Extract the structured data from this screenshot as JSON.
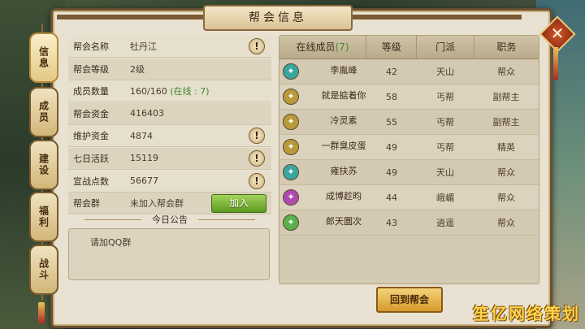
{
  "window": {
    "title": "帮会信息"
  },
  "side_tabs": [
    {
      "label": "信息",
      "active": true
    },
    {
      "label": "成员",
      "active": false
    },
    {
      "label": "建设",
      "active": false
    },
    {
      "label": "福利",
      "active": false
    },
    {
      "label": "战斗",
      "active": false
    }
  ],
  "guild_info": {
    "name_label": "帮会名称",
    "name_value": "牡丹江",
    "level_label": "帮会等级",
    "level_value": "2级",
    "members_label": "成员数量",
    "members_value": "160/160",
    "members_online": "(在线 : 7)",
    "funds_label": "帮会资金",
    "funds_value": "416403",
    "upkeep_label": "维护资金",
    "upkeep_value": "4874",
    "weekly_label": "七日活跃",
    "weekly_value": "15119",
    "warpoints_label": "宣战点数",
    "warpoints_value": "56677",
    "group_label": "帮会群",
    "group_value": "未加入帮会群",
    "join_button": "加入",
    "alert_glyph": "!"
  },
  "notice": {
    "heading": "今日公告",
    "text": "请加QQ群"
  },
  "members_table": {
    "headers": [
      "在线成员",
      "等级",
      "门派",
      "职务"
    ],
    "online_count": "(7)",
    "rows": [
      {
        "name": "李胤峰",
        "level": "42",
        "sect": "天山",
        "role": "帮众",
        "icon_color": "#3aa6a0"
      },
      {
        "name": "就是掂着你",
        "level": "58",
        "sect": "丐帮",
        "role": "副帮主",
        "icon_color": "#b89a3a"
      },
      {
        "name": "冷灵素",
        "level": "55",
        "sect": "丐帮",
        "role": "副帮主",
        "icon_color": "#b89a3a"
      },
      {
        "name": "一群臭皮蛋",
        "level": "49",
        "sect": "丐帮",
        "role": "精英",
        "icon_color": "#b89a3a"
      },
      {
        "name": "雍扶苏",
        "level": "49",
        "sect": "天山",
        "role": "帮众",
        "icon_color": "#3aa6a0"
      },
      {
        "name": "成博趁昀",
        "level": "44",
        "sect": "峨嵋",
        "role": "帮众",
        "icon_color": "#b04ab0"
      },
      {
        "name": "郎天圜次",
        "level": "43",
        "sect": "逍遥",
        "role": "帮众",
        "icon_color": "#5ab04a"
      }
    ]
  },
  "return_button": "回到帮会",
  "close_glyph": "✕",
  "watermark": "笙亿网络策划"
}
